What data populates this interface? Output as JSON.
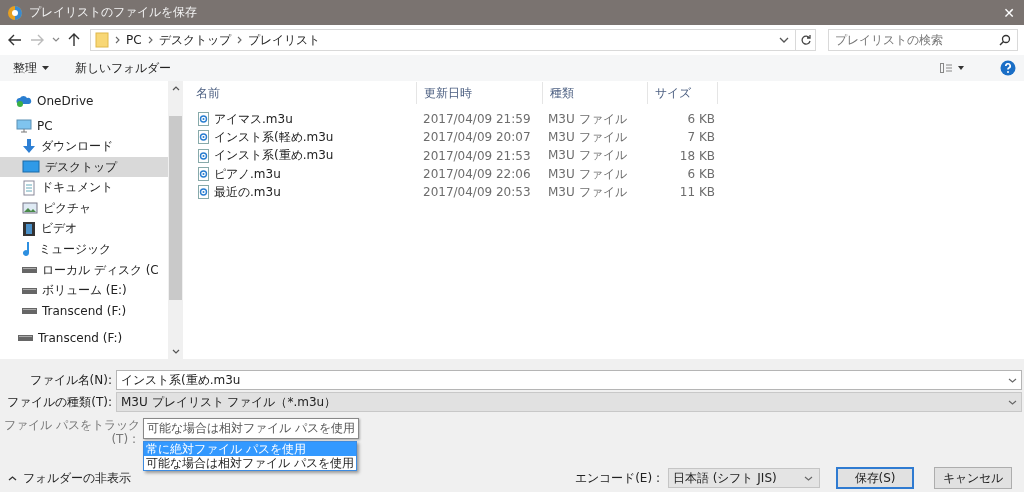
{
  "window": {
    "title": "プレイリストのファイルを保存",
    "close": "✕"
  },
  "nav": {
    "breadcrumb": [
      "PC",
      "デスクトップ",
      "プレイリスト"
    ],
    "search_placeholder": "プレイリストの検索"
  },
  "toolbar": {
    "organize": "整理",
    "new_folder": "新しいフォルダー"
  },
  "sidebar": {
    "items": [
      {
        "label": "OneDrive",
        "kind": "cloud",
        "selected": false
      },
      {
        "label": "PC",
        "kind": "pc",
        "selected": false,
        "children": [
          {
            "label": "ダウンロード",
            "kind": "download",
            "selected": false
          },
          {
            "label": "デスクトップ",
            "kind": "desktop",
            "selected": true
          },
          {
            "label": "ドキュメント",
            "kind": "document",
            "selected": false
          },
          {
            "label": "ピクチャ",
            "kind": "pictures",
            "selected": false
          },
          {
            "label": "ビデオ",
            "kind": "video",
            "selected": false
          },
          {
            "label": "ミュージック",
            "kind": "music",
            "selected": false
          },
          {
            "label": "ローカル ディスク (C",
            "kind": "drive",
            "selected": false
          },
          {
            "label": "ボリューム (E:)",
            "kind": "drive",
            "selected": false
          },
          {
            "label": "Transcend (F:)",
            "kind": "drive",
            "selected": false
          }
        ]
      },
      {
        "label": "Transcend (F:)",
        "kind": "drive",
        "selected": false
      }
    ]
  },
  "table": {
    "columns": [
      "名前",
      "更新日時",
      "種類",
      "サイズ"
    ],
    "rows": [
      [
        "アイマス.m3u",
        "2017/04/09 21:59",
        "M3U ファイル",
        "6 KB"
      ],
      [
        "インスト系(軽め.m3u",
        "2017/04/09 20:07",
        "M3U ファイル",
        "7 KB"
      ],
      [
        "インスト系(重め.m3u",
        "2017/04/09 21:53",
        "M3U ファイル",
        "18 KB"
      ],
      [
        "ピアノ.m3u",
        "2017/04/09 22:06",
        "M3U ファイル",
        "6 KB"
      ],
      [
        "最近の.m3u",
        "2017/04/09 20:53",
        "M3U ファイル",
        "11 KB"
      ]
    ]
  },
  "form": {
    "filename_label": "ファイル名(N):",
    "filename": "インスト系(重め.m3u",
    "type_label": "ファイルの種類(T):",
    "type": "M3U プレイリスト ファイル（*.m3u）",
    "track_label": [
      "ファイル パスをトラック",
      "(T) :"
    ],
    "track_value": "可能な場合は相対ファイル パスを使用",
    "track_options": [
      {
        "label": "常に絶対ファイル パスを使用",
        "selected": true
      },
      {
        "label": "可能な場合は相対ファイル パスを使用",
        "selected": false
      }
    ]
  },
  "footer": {
    "hide_folders": "フォルダーの非表示",
    "encoding_label": "エンコード(E) :",
    "encoding": "日本語 (シフト JIS)",
    "save": "保存(S)",
    "cancel": "キャンセル"
  }
}
